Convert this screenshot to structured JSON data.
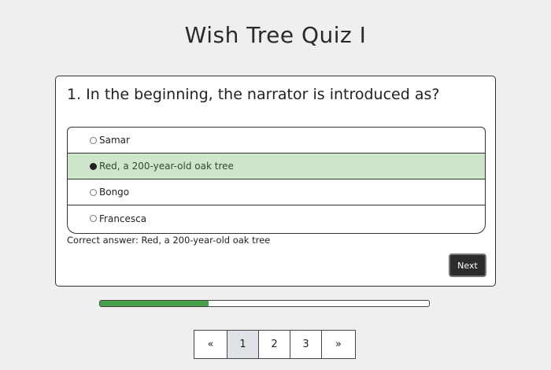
{
  "title": "Wish Tree Quiz I",
  "question": {
    "text": "1. In the beginning, the narrator is introduced as?",
    "options": [
      {
        "label": "Samar",
        "selected": false
      },
      {
        "label": "Red, a 200-year-old oak tree",
        "selected": true
      },
      {
        "label": "Bongo",
        "selected": false
      },
      {
        "label": "Francesca",
        "selected": false
      }
    ],
    "correct_answer": "Correct answer: Red, a 200-year-old oak tree"
  },
  "buttons": {
    "next_label": "Next"
  },
  "progress": {
    "percent": 33
  },
  "pagination": {
    "prev": "«",
    "pages": [
      "1",
      "2",
      "3"
    ],
    "current": "1",
    "next": "»"
  },
  "colors": {
    "selected_bg": "#cfe5cc",
    "progress_fill": "#49a04a",
    "next_button_bg": "#2c2c2c",
    "active_page_bg": "#dfe2e6"
  }
}
